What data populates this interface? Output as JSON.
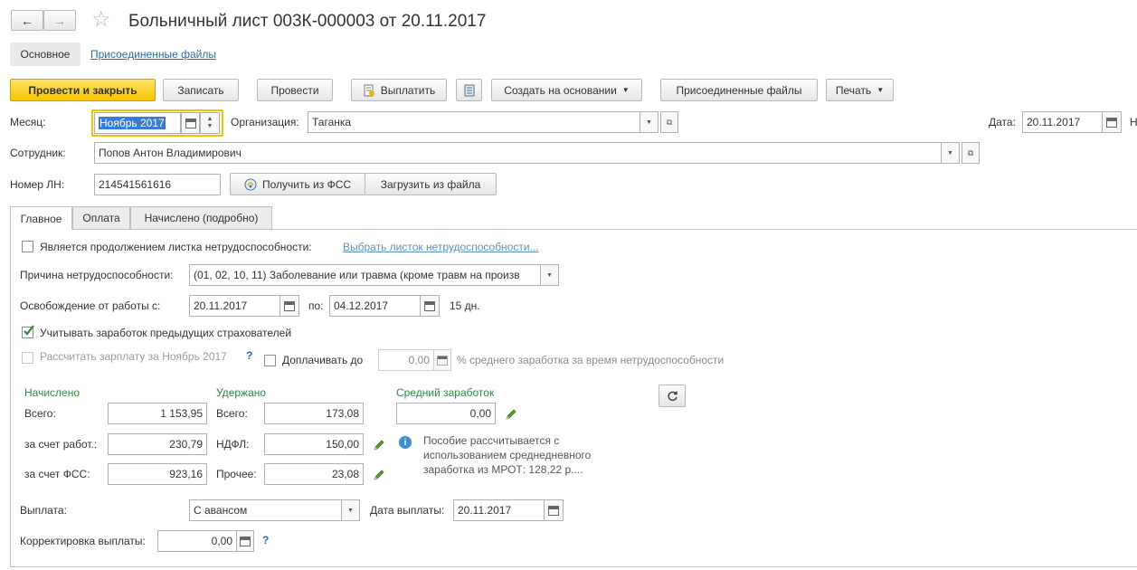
{
  "window": {
    "title": "Больничный лист 003К-000003 от 20.11.2017",
    "nav_back": "←",
    "nav_forward": "→",
    "star": "☆"
  },
  "nav_tabs": {
    "main": "Основное",
    "files": "Присоединенные файлы"
  },
  "toolbar": {
    "post_close": "Провести и закрыть",
    "save": "Записать",
    "post": "Провести",
    "pay": "Выплатить",
    "create_based": "Создать на основании",
    "attached_files": "Присоединенные файлы",
    "print": "Печать"
  },
  "header": {
    "month_label": "Месяц:",
    "month_value": "Ноябрь 2017",
    "org_label": "Организация:",
    "org_value": "Таганка",
    "date_label": "Дата:",
    "date_value": "20.11.2017",
    "trailing_label": "Н",
    "employee_label": "Сотрудник:",
    "employee_value": "Попов Антон Владимирович",
    "ln_label": "Номер ЛН:",
    "ln_value": "214541561616",
    "get_fss": "Получить из ФСС",
    "load_file": "Загрузить из файла"
  },
  "tabs": [
    "Главное",
    "Оплата",
    "Начислено (подробно)"
  ],
  "main_tab": {
    "continuation_label": "Является продолжением листка нетрудоспособности:",
    "choose_sheet_link": "Выбрать листок нетрудоспособности...",
    "reason_label": "Причина нетрудоспособности:",
    "reason_value": "(01, 02, 10, 11) Заболевание или травма (кроме травм на произв",
    "release_label": "Освобождение от работы с:",
    "release_from": "20.11.2017",
    "to_label": "по:",
    "release_to": "04.12.2017",
    "days": "15 дн.",
    "consider_earnings_label": "Учитывать заработок предыдущих страхователей",
    "calc_salary_label": "Рассчитать зарплату за Ноябрь 2017",
    "help": "?",
    "top_up_label": "Доплачивать до",
    "top_up_value": "0,00",
    "top_up_suffix": "% среднего заработка за время нетрудоспособности",
    "accrued_title": "Начислено",
    "withheld_title": "Удержано",
    "avg_title": "Средний заработок",
    "total_label": "Всего:",
    "accrued_total": "1 153,95",
    "employer_label": "за счет работ.:",
    "accrued_employer": "230,79",
    "fss_label": "за счет ФСС:",
    "accrued_fss": "923,16",
    "withheld_total_label": "Всего:",
    "withheld_total": "173,08",
    "ndfl_label": "НДФЛ:",
    "withheld_ndfl": "150,00",
    "other_label": "Прочее:",
    "withheld_other": "23,08",
    "avg_value": "0,00",
    "info_text_1": "Пособие рассчитывается с",
    "info_text_2": "использованием среднедневного",
    "info_text_3": "заработка из МРОТ: 128,22 р....",
    "payout_label": "Выплата:",
    "payout_value": "С авансом",
    "payout_date_label": "Дата выплаты:",
    "payout_date": "20.11.2017",
    "adjust_label": "Корректировка выплаты:",
    "adjust_value": "0,00"
  },
  "colors": {
    "accent_yellow": "#f5c400",
    "green_heading": "#2a8a3a",
    "link_blue": "#2b6aa8"
  }
}
